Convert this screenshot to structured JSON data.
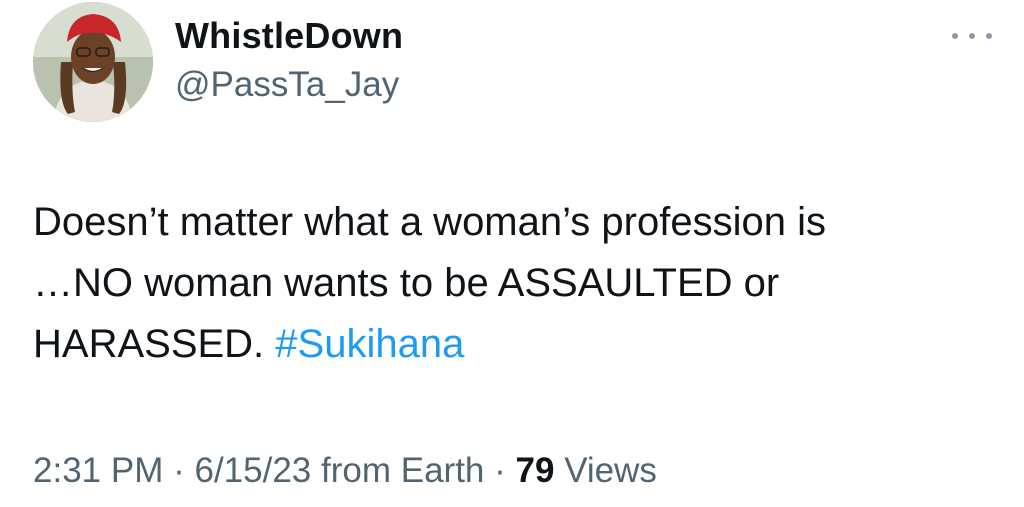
{
  "author": {
    "display_name": "WhistleDown",
    "handle": "@PassTa_Jay",
    "avatar_icon": "profile-photo"
  },
  "tweet": {
    "lines": [
      "Doesn’t matter what a woman’s profession is",
      "…NO woman wants to be ASSAULTED or"
    ],
    "last_line_text": "HARASSED.",
    "hashtag": "#Sukihana"
  },
  "meta": {
    "time": "2:31 PM",
    "separator": "·",
    "date": "6/15/23",
    "source": "from Earth",
    "views_count": "79",
    "views_label": "Views"
  },
  "colors": {
    "text": "#0f1419",
    "secondary": "#536471",
    "link": "#1d9bf0"
  }
}
